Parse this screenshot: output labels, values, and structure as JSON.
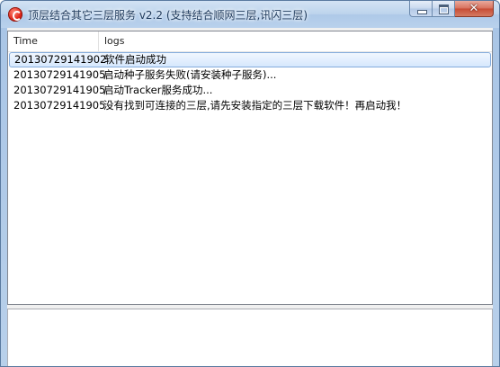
{
  "window": {
    "title": "顶层结合其它三层服务 v2.2  (支持结合顺网三层,讯闪三层)",
    "close_glyph": "✕"
  },
  "log_list": {
    "columns": {
      "time": "Time",
      "logs": "logs"
    },
    "rows": [
      {
        "time": "20130729141902",
        "log": "软件启动成功"
      },
      {
        "time": "20130729141905",
        "log": "启动种子服务失败(请安装种子服务)..."
      },
      {
        "time": "20130729141905",
        "log": "启动Tracker服务成功..."
      },
      {
        "time": "20130729141905",
        "log": "没有找到可连接的三层,请先安装指定的三层下载软件！再启动我！"
      }
    ],
    "selected_index": 0
  },
  "log_textbox": {
    "value": ""
  }
}
